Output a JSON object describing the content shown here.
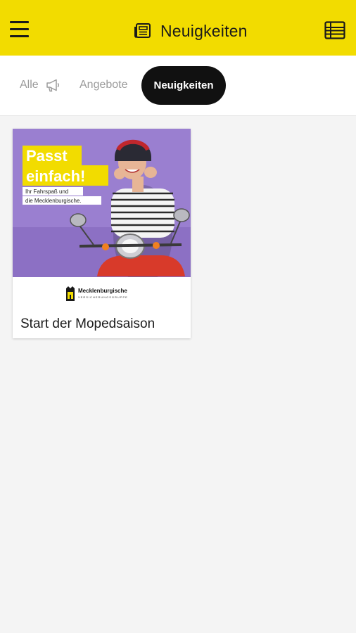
{
  "header": {
    "title": "Neuigkeiten",
    "menu_icon": "hamburger-menu-icon",
    "title_icon": "newspaper-icon",
    "list_icon": "table-list-icon",
    "background": "#f2dc00"
  },
  "tabs": [
    {
      "label": "Alle",
      "icon": "megaphone-icon",
      "active": false
    },
    {
      "label": "Angebote",
      "active": false
    },
    {
      "label": "Neuigkeiten",
      "active": true
    }
  ],
  "cards": [
    {
      "title": "Start der Mopedsaison",
      "image": {
        "headline_1": "Passt",
        "headline_2": "einfach!",
        "tagline_1": "Ihr Fahrspaß und",
        "tagline_2": "die Mecklenburgische.",
        "background": "#9a7fd0"
      },
      "logo_text": "Mecklenburgische",
      "logo_subtext": "VERSICHERUNGSGRUPPE"
    }
  ]
}
